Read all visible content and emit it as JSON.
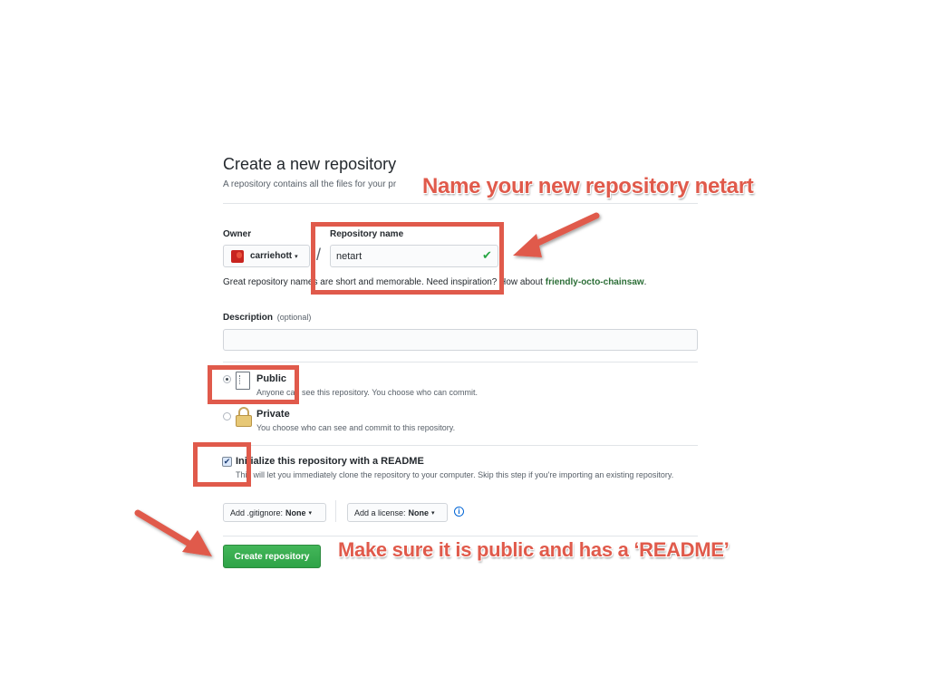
{
  "form": {
    "title": "Create a new repository",
    "subtitle": "A repository contains all the files for your pr",
    "owner_label": "Owner",
    "owner_value": "carriehott",
    "repo_name_label": "Repository name",
    "repo_name_value": "netart",
    "separator": "/",
    "suggestion_prefix": "Great repository names are short and memorable. Need inspiration? How about ",
    "suggestion_name": "friendly-octo-chainsaw",
    "suggestion_suffix": ".",
    "description_label": "Description",
    "description_optional": "(optional)",
    "description_value": "",
    "visibility": {
      "selected": "Public",
      "public_title": "Public",
      "public_desc": "Anyone can see this repository. You choose who can commit.",
      "private_title": "Private",
      "private_desc": "You choose who can see and commit to this repository."
    },
    "readme": {
      "checked": true,
      "title": "Initialize this repository with a README",
      "desc": "This will let you immediately clone the repository to your computer. Skip this step if you're importing an existing repository."
    },
    "gitignore_label": "Add .gitignore:",
    "gitignore_value": "None",
    "license_label": "Add a license:",
    "license_value": "None",
    "submit_label": "Create repository"
  },
  "annotations": {
    "top": "Name your new repository netart",
    "bottom": "Make sure it is public and has a ‘README’",
    "color": "#e05a4b"
  },
  "icons": {
    "valid_check": "✔",
    "caret": "▾",
    "info": "i",
    "checkbox_mark": "✔"
  },
  "colors": {
    "accent_green": "#2ea44f",
    "suggestion_green": "#2c6e37",
    "annotation_red": "#e05a4b"
  }
}
